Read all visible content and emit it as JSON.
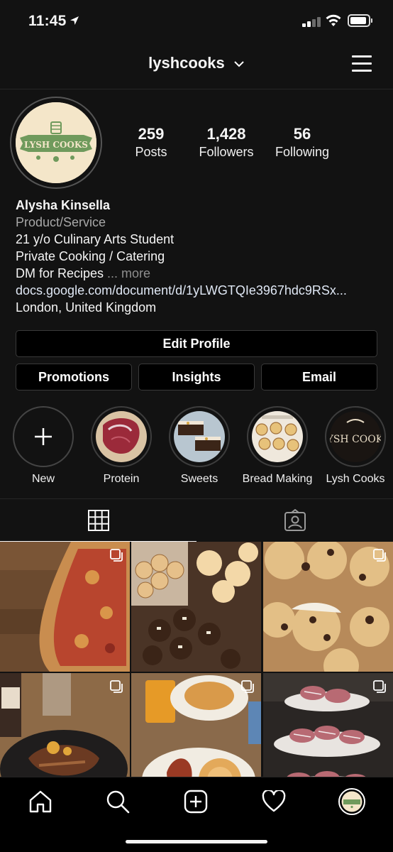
{
  "status_bar": {
    "time": "11:45",
    "location_arrow": "➤"
  },
  "header": {
    "username": "lyshcooks"
  },
  "profile": {
    "logo_text": "LYSH COOKS",
    "stats": [
      {
        "count": "259",
        "label": "Posts"
      },
      {
        "count": "1,428",
        "label": "Followers"
      },
      {
        "count": "56",
        "label": "Following"
      }
    ],
    "name": "Alysha Kinsella",
    "category": "Product/Service",
    "bio_lines": [
      "21 y/o Culinary Arts Student",
      "Private Cooking / Catering",
      "DM for Recipes"
    ],
    "more_label": "... more",
    "link": "docs.google.com/document/d/1yLWGTQIe3967hdc9RSx...",
    "location": "London, United Kingdom"
  },
  "buttons": {
    "edit_profile": "Edit Profile",
    "promotions": "Promotions",
    "insights": "Insights",
    "email": "Email"
  },
  "highlights": [
    {
      "label": "New",
      "icon": "plus-icon"
    },
    {
      "label": "Protein"
    },
    {
      "label": "Sweets"
    },
    {
      "label": "Bread Making"
    },
    {
      "label": "Lysh Cooks",
      "logo_text": "LYSH COOKS"
    }
  ],
  "tabs": [
    {
      "name": "grid",
      "icon": "grid-icon",
      "active": true
    },
    {
      "name": "tagged",
      "icon": "tagged-icon",
      "active": false
    }
  ],
  "posts": [
    {
      "subject": "pizza",
      "multi": true
    },
    {
      "subject": "cupcakes-cookies-buns",
      "multi": false
    },
    {
      "subject": "chocolate-chip-muffins",
      "multi": true
    },
    {
      "subject": "steak-dinner",
      "multi": true
    },
    {
      "subject": "pancakes-breakfast",
      "multi": true
    },
    {
      "subject": "cake-stand-cookies",
      "multi": true
    }
  ],
  "bottom_nav": [
    "home-icon",
    "search-icon",
    "new-post-icon",
    "activity-heart-icon",
    "profile-avatar"
  ],
  "colors": {
    "background": "#121212",
    "logo_green": "#6f9a5c",
    "logo_cream": "#f4e6c9"
  }
}
